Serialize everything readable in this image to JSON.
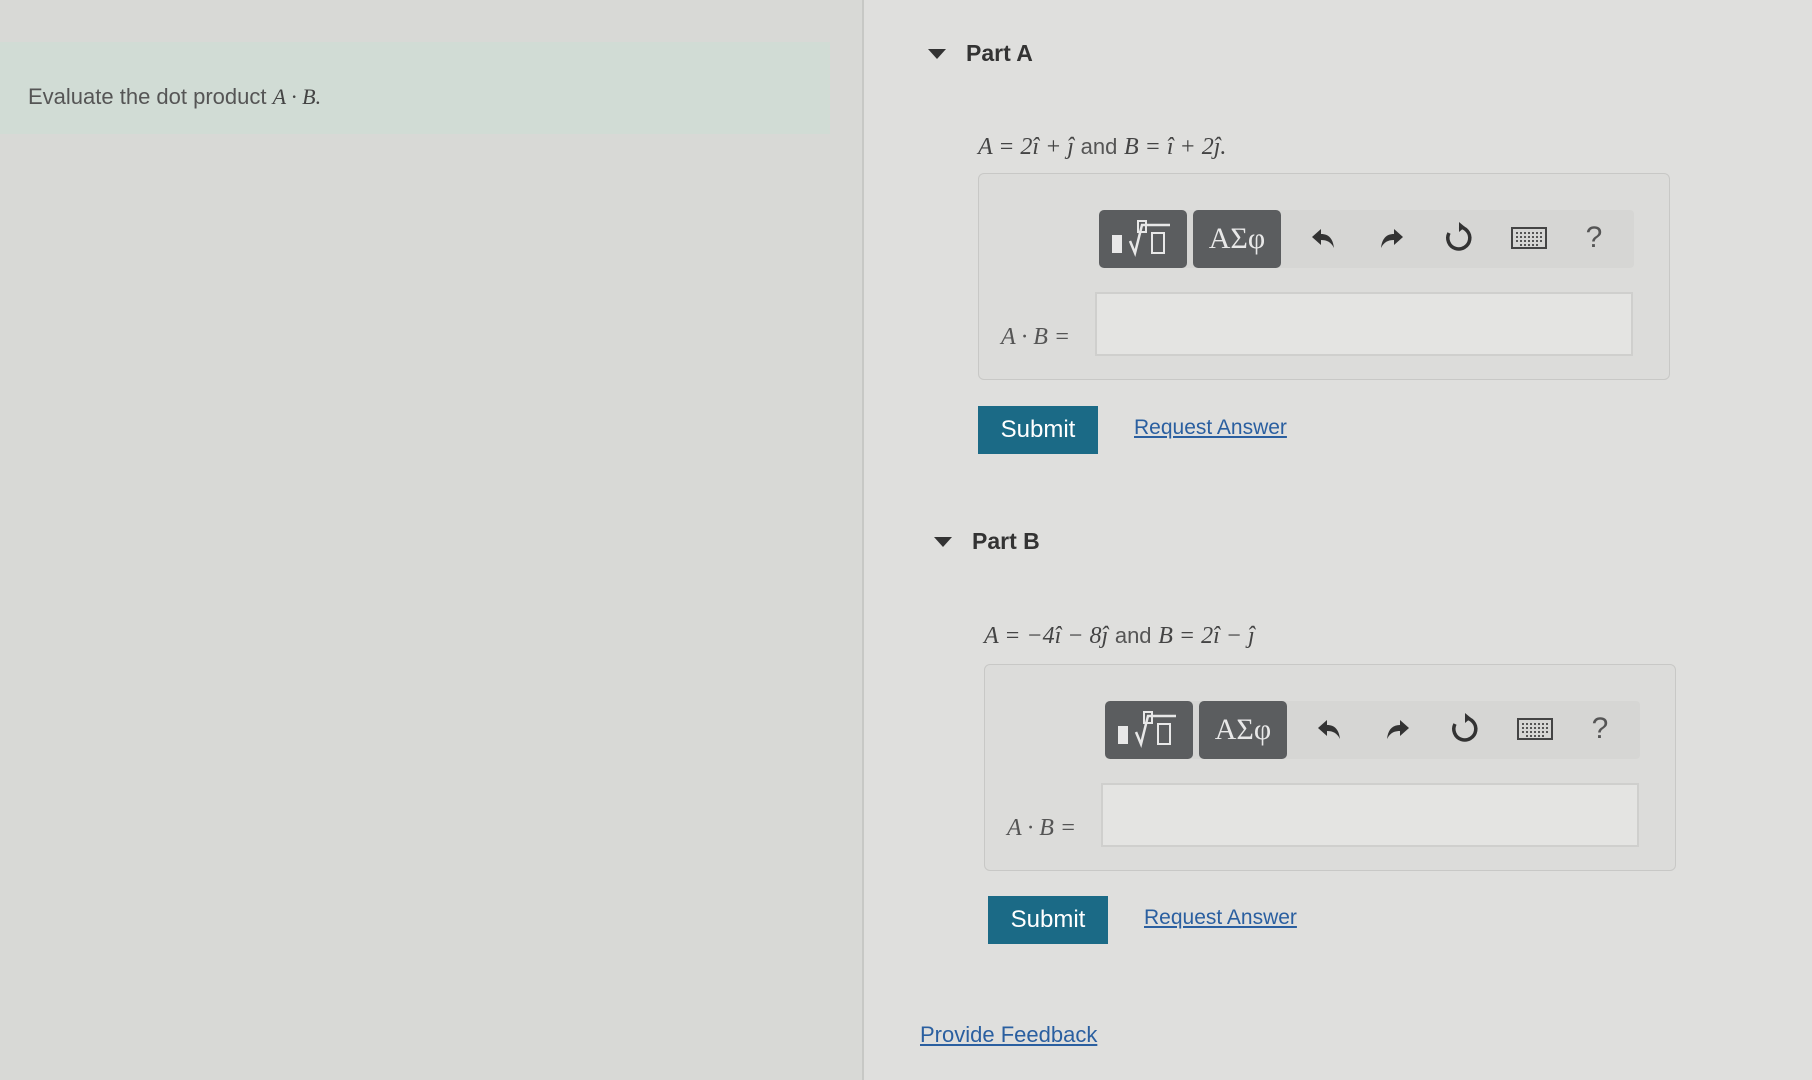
{
  "intro": {
    "text": "Evaluate the dot product",
    "math": "A · B."
  },
  "parts": [
    {
      "title": "Part A",
      "statement_a": "A = 2î + ĵ",
      "statement_and": "and",
      "statement_b": "B = î + 2ĵ.",
      "answer_label": "A · B =",
      "input_value": "",
      "submit": "Submit",
      "request": "Request Answer"
    },
    {
      "title": "Part B",
      "statement_a": "A = −4î − 8ĵ",
      "statement_and": "and",
      "statement_b": "B = 2î − ĵ",
      "answer_label": "A · B =",
      "input_value": "",
      "submit": "Submit",
      "request": "Request Answer"
    }
  ],
  "toolbar": {
    "symbols": "ΑΣφ",
    "help": "?",
    "icons": [
      "templates-icon",
      "greek-symbols",
      "undo-icon",
      "redo-icon",
      "reset-icon",
      "keyboard-icon",
      "help-icon"
    ]
  },
  "footer": {
    "feedback": "Provide Feedback"
  },
  "colors": {
    "submit": "#1b6a86",
    "link": "#2a5fa0",
    "toolbar_button": "#5b5d5f"
  }
}
